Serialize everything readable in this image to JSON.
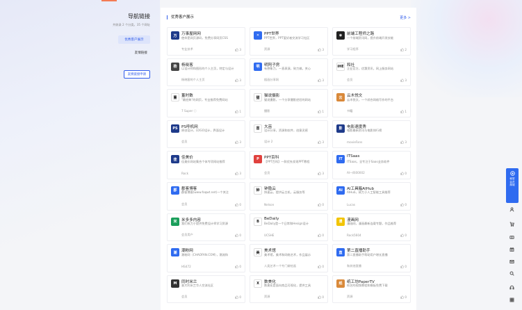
{
  "nav": {
    "title": "导航链接",
    "subtitle": "共收录 2 个分类，35 个网址",
    "items": [
      {
        "label": "优秀客户展示",
        "active": true
      },
      {
        "label": "友情链接",
        "active": false
      }
    ],
    "apply_label": "友情链接申请"
  },
  "section": {
    "title": "优秀客户展示",
    "more": "更多 >"
  },
  "cards": [
    {
      "name": "万事屋网网",
      "desc": "使命是网页源码，免费分享网页CSS",
      "foot": "专业技术",
      "likes": "3",
      "logo": "万",
      "logo_bg": "#1e3a8a"
    },
    {
      "name": "PPT世界",
      "desc": "PPT世界，PPT爱好者交流学习社区",
      "foot": "资源",
      "likes": "3",
      "logo": "✕",
      "logo_bg": "#2f6bf0"
    },
    {
      "name": "前端工程师之路",
      "desc": "一个前端资讯网，提升前端开发技能",
      "foot": "学习程序",
      "likes": "2",
      "logo": "◉",
      "logo_bg": "#222222"
    },
    {
      "name": "杨晓客",
      "desc": "以设计师和图形的个人主页，特定与设计",
      "foot": "杨晓客的个人主页",
      "likes": "3",
      "logo": "杨",
      "logo_bg": "#444444"
    },
    {
      "name": "明阿子房",
      "desc": "有想象力，一直表演，致力做。关心",
      "foot": "插画分享网",
      "likes": "3",
      "logo": "明",
      "logo_bg": "#2f6bf0"
    },
    {
      "name": "和社",
      "desc": "企业官方，优惠资讯，网上服务网站",
      "foot": "会员",
      "likes": "3",
      "logo": "iHE",
      "logo_bg": "#ffffff"
    },
    {
      "name": "董时数",
      "desc": "\"最经典\"的网页，专业推荐免费网站",
      "foot": "7 Super ⓘ",
      "likes": "1",
      "logo": "董",
      "logo_bg": "#ffffff"
    },
    {
      "name": "猫说摄影",
      "desc": "猫说摄影，一个分享摄影经验的网站",
      "foot": "摄影",
      "likes": "1",
      "logo": "猫",
      "logo_bg": "#ffffff"
    },
    {
      "name": "云木悦文",
      "desc": "云木悦文，一个综合网络写作的平台",
      "foot": "书籍",
      "likes": "1",
      "logo": "云",
      "logo_bg": "#d9893a"
    },
    {
      "name": "PS呼机网",
      "desc": "原创设计，LOGO设计，界面设计",
      "foot": "会员",
      "likes": "3",
      "logo": "PS",
      "logo_bg": "#1e3a8a"
    },
    {
      "name": "大苗",
      "desc": "设计分享，资源和软件，创意灵感",
      "foot": "设计 2",
      "likes": "3",
      "logo": "苗",
      "logo_bg": "#ffffff"
    },
    {
      "name": "电影速度秀",
      "desc": "电影最新资讯与电影排行榜",
      "foot": "movieFans",
      "likes": "3",
      "logo": "影",
      "logo_bg": "#1e3a8a"
    },
    {
      "name": "佳美价",
      "desc": "佳美价网站集合个体专项网站推荐",
      "foot": "Rock",
      "likes": "3",
      "logo": "佳",
      "logo_bg": "#1e3a8a"
    },
    {
      "name": "PPT百科",
      "desc": "【PPT百科】一款优先发现PPT教程",
      "foot": "会员",
      "likes": "3",
      "logo": "P",
      "logo_bg": "#e0413d"
    },
    {
      "name": "ITSaas",
      "desc": "ITSaas，全专注于Saas业务软件",
      "foot": "AI一四00002",
      "likes": "0",
      "logo": "IT",
      "logo_bg": "#2f6bf0"
    },
    {
      "name": "郡客博客",
      "desc": "郡客博客(www.foqwt.net)一个关注",
      "foot": "会员",
      "likes": "0",
      "logo": "郡",
      "logo_bg": "#2f6bf0"
    },
    {
      "name": "钟隐云",
      "desc": "快速云，提供云主机，云服务等",
      "foot": "Nelson",
      "likes": "0",
      "logo": "钟",
      "logo_bg": "#ffffff"
    },
    {
      "name": "AI工具箱AIHub",
      "desc": "AIHub，致力于人工智能工具推荐",
      "foot": "Lucas",
      "likes": "0",
      "logo": "AI",
      "logo_bg": "#2f6bf0"
    },
    {
      "name": "米多多内容",
      "desc": "我们致力于提供免费设计师学习资源",
      "foot": "会员用户",
      "likes": "0",
      "logo": "米",
      "logo_bg": "#1a9e5a"
    },
    {
      "name": "BeDaily",
      "desc": "BeDaily是一个日常和Hesign设计",
      "foot": "UCSHE",
      "likes": "0",
      "logo": "B",
      "logo_bg": "#ffffff"
    },
    {
      "name": "漫画网",
      "desc": "漫画网，漫画最新连载专题，作品推荐",
      "foot": "Rock5604",
      "likes": "0",
      "logo": "漫",
      "logo_bg": "#f2c400"
    },
    {
      "name": "潮粉网",
      "desc": "潮粉网（CHAOFAN.COM），潮流和",
      "foot": "HS472",
      "likes": "0",
      "logo": "潮",
      "logo_bg": "#2f6bf0"
    },
    {
      "name": "美术馆",
      "desc": "美术馆，美术和网络艺术，作品展示",
      "foot": "人类艺术一个专门做绘画",
      "likes": "0",
      "logo": "美",
      "logo_bg": "#ffffff"
    },
    {
      "name": "第二直播助手",
      "desc": "第二直播助手帮助用户增长直播",
      "foot": "和其他直播",
      "likes": "0",
      "logo": "直",
      "logo_bg": "#2f6bf0"
    },
    {
      "name": "同时米兰",
      "desc": "意大利米兰华人交流社区",
      "foot": "会员",
      "likes": "0",
      "logo": "M",
      "logo_bg": "#333333"
    },
    {
      "name": "数美化",
      "desc": "数美化是面向商品可视化，提供工具",
      "foot": "资源",
      "likes": "0",
      "logo": "X",
      "logo_bg": "#ffffff"
    },
    {
      "name": "纸工坊PaperTV",
      "desc": "纸艺的视频教程和模板免费下载",
      "foot": "资源",
      "likes": "0",
      "logo": "纸",
      "logo_bg": "#d9893a"
    }
  ],
  "fab": {
    "label_1": "秘密",
    "label_2": "会员",
    "label_3": "商城"
  },
  "tools": [
    "user-icon",
    "cart-icon",
    "ticket-icon",
    "gift-icon",
    "mail-icon",
    "search-icon",
    "headset-icon",
    "grid-icon"
  ],
  "colors": {
    "accent": "#2f5bea",
    "top_accent": "#f37b54"
  }
}
